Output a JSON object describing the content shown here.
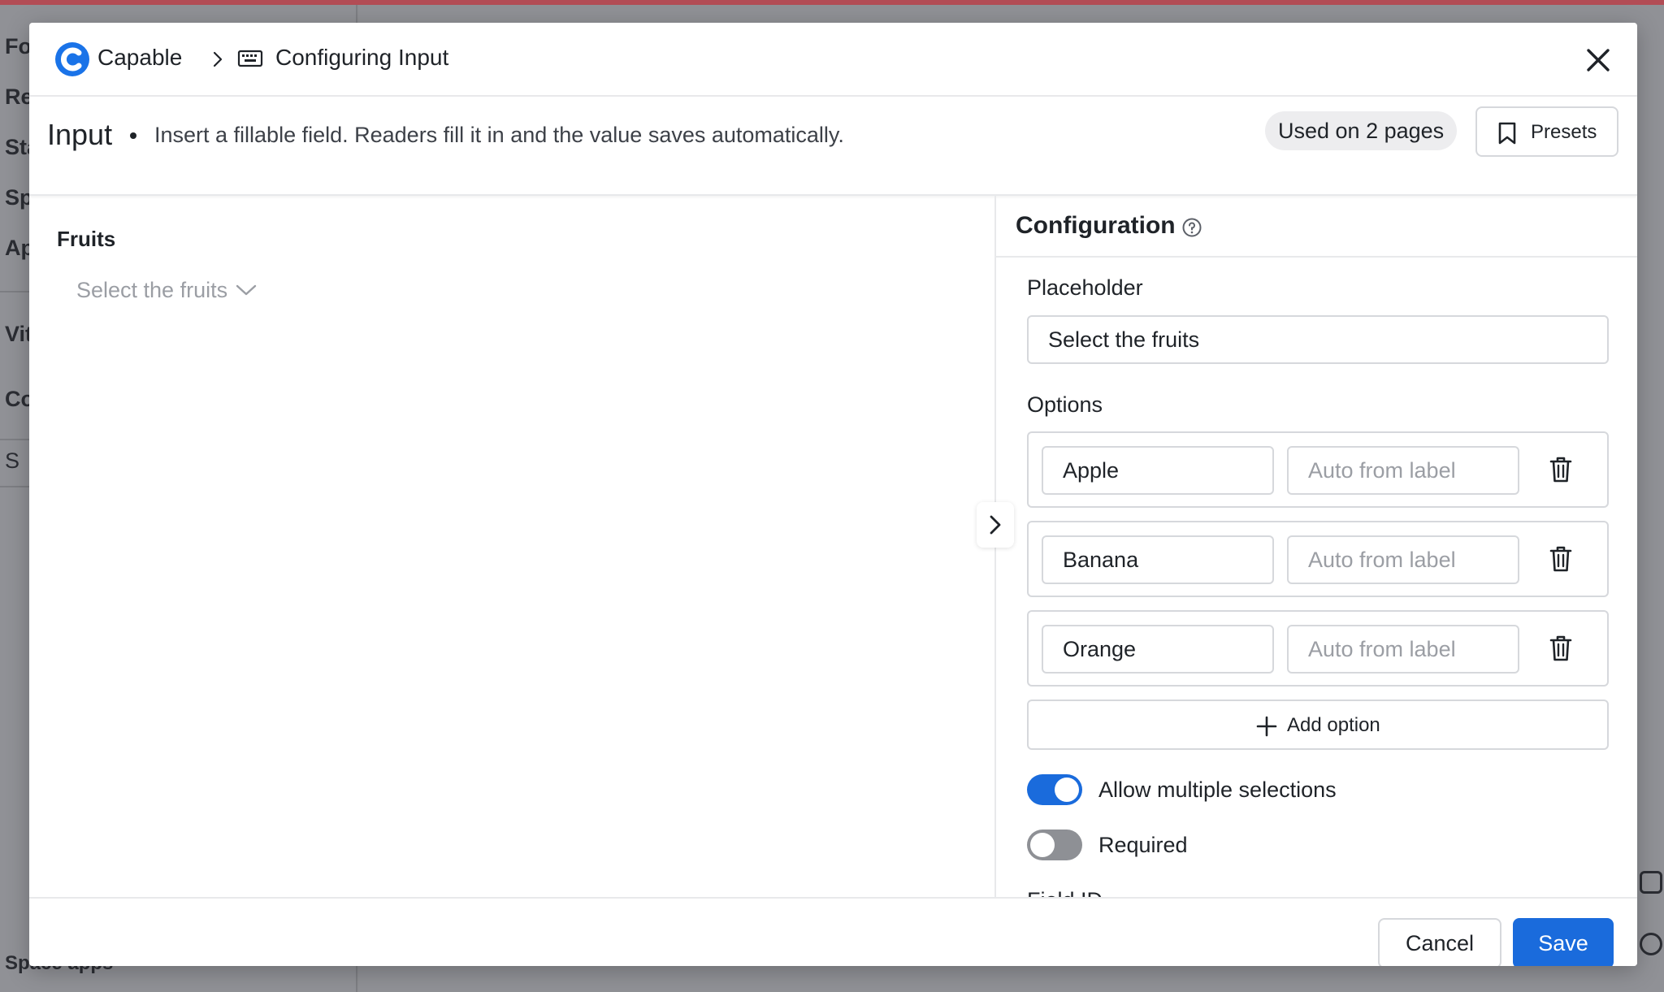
{
  "background": {
    "sidebar_items": [
      "Fo",
      "Re",
      "Sta",
      "Sp",
      "Ap",
      "Vit",
      "Co",
      "S"
    ],
    "footer_text": "Space apps"
  },
  "modal": {
    "brand": "Capable",
    "breadcrumb_title": "Configuring Input",
    "block_name": "Input",
    "block_description": "Insert a fillable field. Readers fill it in and the value saves automatically.",
    "usage": "Used on 2 pages",
    "presets_label": "Presets",
    "accent_color": "#1a6bdc"
  },
  "preview": {
    "field_label": "Fruits",
    "placeholder": "Select the fruits"
  },
  "config": {
    "title": "Configuration",
    "placeholder_label": "Placeholder",
    "placeholder_value": "Select the fruits",
    "options_label": "Options",
    "options": [
      {
        "label": "Apple",
        "value_placeholder": "Auto from label"
      },
      {
        "label": "Banana",
        "value_placeholder": "Auto from label"
      },
      {
        "label": "Orange",
        "value_placeholder": "Auto from label"
      }
    ],
    "add_option_label": "Add option",
    "allow_multiple_label": "Allow multiple selections",
    "allow_multiple": true,
    "required_label": "Required",
    "required": false,
    "cut_off_label": "Field ID"
  },
  "footer": {
    "cancel_label": "Cancel",
    "save_label": "Save"
  }
}
